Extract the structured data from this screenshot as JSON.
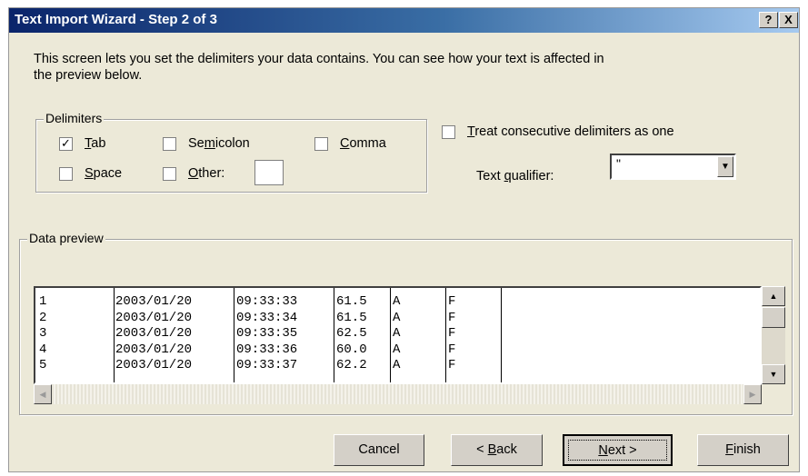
{
  "window": {
    "title": "Text Import Wizard - Step 2 of 3",
    "help_label": "?",
    "close_label": "X"
  },
  "intro": "This screen lets you set the delimiters your data contains.  You can see how your text is affected in the preview below.",
  "delimiters": {
    "legend": "Delimiters",
    "tab": {
      "label": "Tab",
      "checked": true
    },
    "semicolon": {
      "label": "Semicolon",
      "checked": false
    },
    "comma": {
      "label": "Comma",
      "checked": false
    },
    "space": {
      "label": "Space",
      "checked": false
    },
    "other": {
      "label": "Other:",
      "checked": false,
      "value": ""
    }
  },
  "consecutive": {
    "label": "Treat consecutive delimiters as one",
    "checked": false
  },
  "text_qualifier": {
    "label": "Text qualifier:",
    "value": "\""
  },
  "preview": {
    "legend": "Data preview",
    "rows": [
      [
        "1",
        "2003/01/20",
        "09:33:33",
        "61.5",
        "A",
        "F"
      ],
      [
        "2",
        "2003/01/20",
        "09:33:34",
        "61.5",
        "A",
        "F"
      ],
      [
        "3",
        "2003/01/20",
        "09:33:35",
        "62.5",
        "A",
        "F"
      ],
      [
        "4",
        "2003/01/20",
        "09:33:36",
        "60.0",
        "A",
        "F"
      ],
      [
        "5",
        "2003/01/20",
        "09:33:37",
        "62.2",
        "A",
        "F"
      ]
    ]
  },
  "buttons": {
    "cancel": "Cancel",
    "back": "< Back",
    "next": "Next >",
    "finish": "Finish"
  },
  "icons": {
    "checked_mark": "✓",
    "scroll_up": "▲",
    "scroll_down": "▼",
    "scroll_left": "◀",
    "scroll_right": "▶",
    "dropdown": "▼"
  }
}
